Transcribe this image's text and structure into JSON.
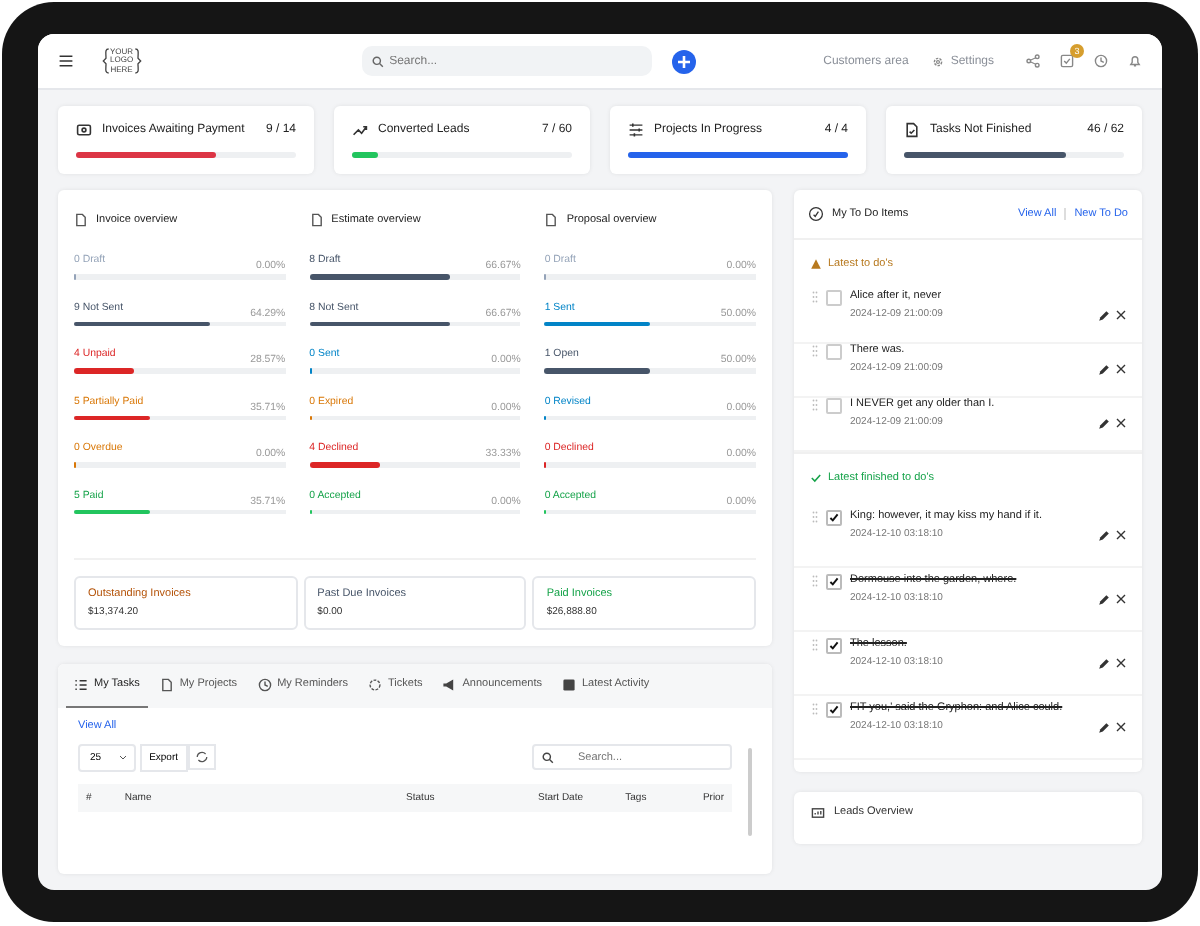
{
  "topbar": {
    "logo": [
      "YOUR",
      "LOGO",
      "HERE"
    ],
    "search": {
      "placeholder": "Search..."
    },
    "customers_area": "Customers area",
    "settings": "Settings",
    "tasks_badge": "3"
  },
  "stats": [
    {
      "kind": "invoice",
      "label": "Invoices Awaiting Payment",
      "value": "9 / 14",
      "level": 0.64,
      "color": "#dc3545"
    },
    {
      "kind": "leads",
      "label": "Converted Leads",
      "value": "7 / 60",
      "level": 0.12,
      "color": "#22c55e"
    },
    {
      "kind": "projects",
      "label": "Projects In Progress",
      "value": "4 / 4",
      "level": 1,
      "color": "#2563eb"
    },
    {
      "kind": "tasks",
      "label": "Tasks Not Finished",
      "value": "46 / 62",
      "level": 0.74,
      "color": "#475569"
    }
  ],
  "overviews": [
    {
      "title": "Invoice overview",
      "rows": [
        {
          "kind": "draft",
          "label": "0 Draft",
          "percent": "0.00%",
          "level": 0
        },
        {
          "kind": "not_sent",
          "label": "9 Not Sent",
          "percent": "64.29%",
          "level": 0.6429
        },
        {
          "kind": "unpaid",
          "label": "4 Unpaid",
          "percent": "28.57%",
          "level": 0.2857
        },
        {
          "kind": "partial",
          "label": "5 Partially Paid",
          "percent": "35.71%",
          "level": 0.3571
        },
        {
          "kind": "overdue",
          "label": "0 Overdue",
          "percent": "0.00%",
          "level": 0
        },
        {
          "kind": "paid",
          "label": "5 Paid",
          "percent": "35.71%",
          "level": 0.3571
        }
      ]
    },
    {
      "title": "Estimate overview",
      "rows": [
        {
          "kind": "not_sent",
          "label": "8 Draft",
          "percent": "66.67%",
          "level": 0.6667
        },
        {
          "kind": "not_sent",
          "label": "8 Not Sent",
          "percent": "66.67%",
          "level": 0.6667
        },
        {
          "kind": "sent",
          "label": "0 Sent",
          "percent": "0.00%",
          "level": 0
        },
        {
          "kind": "overdue",
          "label": "0 Expired",
          "percent": "0.00%",
          "level": 0
        },
        {
          "kind": "declined",
          "label": "4 Declined",
          "percent": "33.33%",
          "level": 0.3333
        },
        {
          "kind": "paid",
          "label": "0 Accepted",
          "percent": "0.00%",
          "level": 0
        }
      ]
    },
    {
      "title": "Proposal overview",
      "rows": [
        {
          "kind": "draft",
          "label": "0 Draft",
          "percent": "0.00%",
          "level": 0
        },
        {
          "kind": "sent",
          "label": "1 Sent",
          "percent": "50.00%",
          "level": 0.5
        },
        {
          "kind": "not_sent",
          "label": "1 Open",
          "percent": "50.00%",
          "level": 0.5
        },
        {
          "kind": "sent",
          "label": "0 Revised",
          "percent": "0.00%",
          "level": 0
        },
        {
          "kind": "declined",
          "label": "0 Declined",
          "percent": "0.00%",
          "level": 0
        },
        {
          "kind": "paid",
          "label": "0 Accepted",
          "percent": "0.00%",
          "level": 0
        }
      ]
    }
  ],
  "totals": [
    {
      "label": "Outstanding Invoices",
      "amount": "$13,374.20",
      "color": "#b45309"
    },
    {
      "label": "Past Due Invoices",
      "amount": "$0.00",
      "color": "#475569"
    },
    {
      "label": "Paid Invoices",
      "amount": "$26,888.80",
      "color": "#16a34a"
    }
  ],
  "tasks_panel": {
    "tabs": [
      {
        "kind": "list",
        "label": "My Tasks",
        "selected": true
      },
      {
        "kind": "project",
        "label": "My Projects",
        "selected": false
      },
      {
        "kind": "clock",
        "label": "My Reminders",
        "selected": false
      },
      {
        "kind": "ticket",
        "label": "Tickets",
        "selected": false
      },
      {
        "kind": "megaphone",
        "label": "Announcements",
        "selected": false
      },
      {
        "kind": "calendar",
        "label": "Latest Activity",
        "selected": false
      }
    ],
    "view_all": "View All",
    "page_size": "25",
    "export": "Export",
    "search": {
      "placeholder": "Search..."
    },
    "columns": [
      "#",
      "Name",
      "Status",
      "Start Date",
      "Tags",
      "Prior"
    ]
  },
  "todo": {
    "title": "My To Do Items",
    "view_all": "View All",
    "new_todo": "New To Do",
    "latest_heading": "Latest to do's",
    "latest": [
      {
        "text": "Alice after it, never",
        "date": "2024-12-09 21:00:09",
        "checked": false,
        "strikethrough": false
      },
      {
        "text": "There was.",
        "date": "2024-12-09 21:00:09",
        "checked": false,
        "strikethrough": false
      },
      {
        "text": "I NEVER get any older than I.",
        "date": "2024-12-09 21:00:09",
        "checked": false,
        "strikethrough": false
      }
    ],
    "finished_heading": "Latest finished to do's",
    "finished": [
      {
        "text": "King: however, it may kiss my hand if it.",
        "date": "2024-12-10 03:18:10",
        "checked": true,
        "strikethrough": false
      },
      {
        "text": "Dormouse into the garden, where.",
        "date": "2024-12-10 03:18:10",
        "checked": true,
        "strikethrough": true
      },
      {
        "text": "The lesson.",
        "date": "2024-12-10 03:18:10",
        "checked": true,
        "strikethrough": true
      },
      {
        "text": "FIT you,' said the Gryphon: and Alice could.",
        "date": "2024-12-10 03:18:10",
        "checked": true,
        "strikethrough": true
      }
    ]
  },
  "leads_overview": {
    "title": "Leads Overview"
  }
}
